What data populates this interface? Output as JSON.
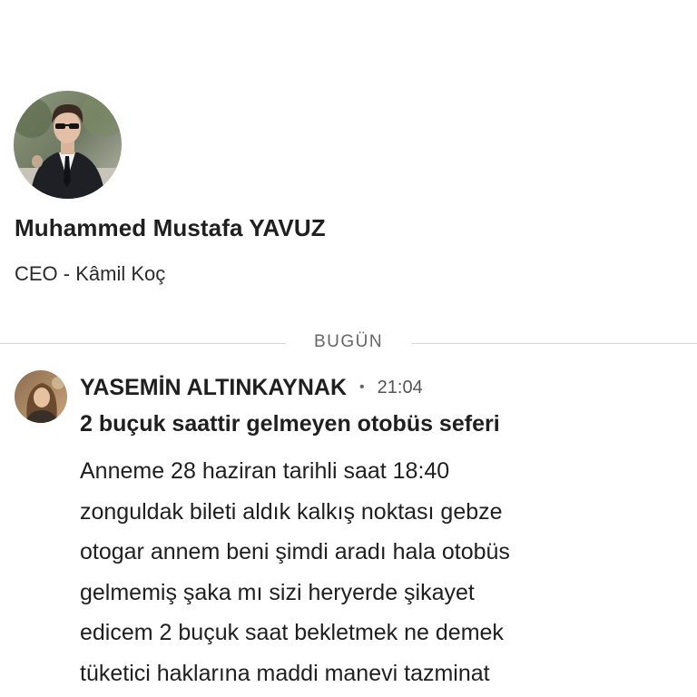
{
  "profile": {
    "name": "Muhammed Mustafa YAVUZ",
    "title": "CEO - Kâmil Koç"
  },
  "divider": {
    "label": "BUGÜN"
  },
  "message": {
    "sender": "YASEMİN ALTINKAYNAK",
    "separator": "•",
    "time": "21:04",
    "subject": "2 buçuk saattir gelmeyen otobüs seferi",
    "body_lines": [
      "Anneme 28 haziran tarihli saat 18:40",
      "zonguldak bileti aldık kalkış noktası gebze",
      "otogar annem beni şimdi aradı hala otobüs",
      "gelmemiş şaka mı sizi heryerde şikayet",
      "edicem 2 buçuk saat bekletmek ne demek",
      "tüketici haklarına maddi manevi tazminat"
    ]
  }
}
